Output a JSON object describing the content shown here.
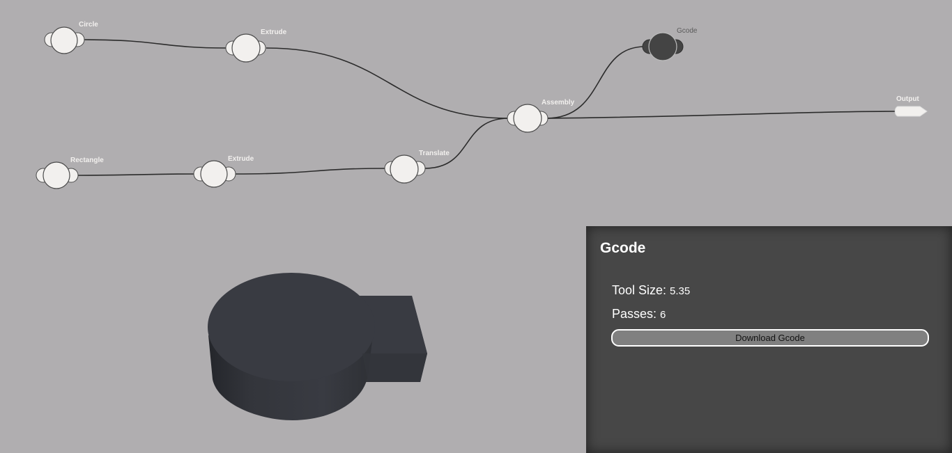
{
  "graph": {
    "nodes": [
      {
        "id": "circle",
        "label": "Circle"
      },
      {
        "id": "extrude1",
        "label": "Extrude"
      },
      {
        "id": "rectangle",
        "label": "Rectangle"
      },
      {
        "id": "extrude2",
        "label": "Extrude"
      },
      {
        "id": "translate",
        "label": "Translate"
      },
      {
        "id": "assembly",
        "label": "Assembly"
      },
      {
        "id": "gcode",
        "label": "Gcode"
      },
      {
        "id": "output",
        "label": "Output"
      }
    ],
    "selected_node": "gcode"
  },
  "panel": {
    "title": "Gcode",
    "tool_size_label": "Tool Size:",
    "tool_size_value": "5.35",
    "passes_label": "Passes:",
    "passes_value": "6",
    "download_label": "Download Gcode"
  },
  "colors": {
    "background": "#b0aeb0",
    "node_fill": "#f2f0ee",
    "selected_node_fill": "#444444",
    "panel_bg": "#474747",
    "model_color": "#393b42"
  }
}
